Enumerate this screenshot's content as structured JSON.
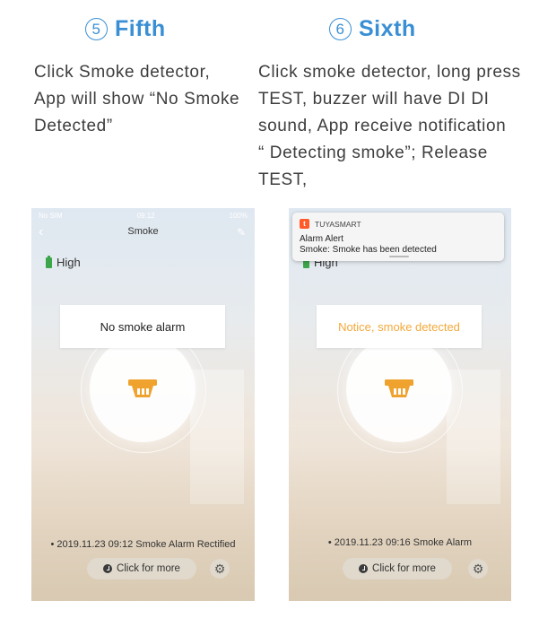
{
  "step5": {
    "number": "5",
    "title": "Fifth",
    "description_lines": [
      "Click Smoke detector,",
      "App will show “No Smoke",
      "Detected”"
    ]
  },
  "step6": {
    "number": "6",
    "title": "Sixth",
    "description_lines": [
      "Click smoke detector, long press",
      "TEST, buzzer will have DI DI",
      "sound, App receive notification",
      "“ Detecting smoke”; Release",
      "TEST,"
    ]
  },
  "screen5": {
    "status_left": "No SIM",
    "status_time": "09:12",
    "status_right": "100%",
    "nav_title": "Smoke",
    "battery_label": "High",
    "alarm_text": "No smoke alarm",
    "history_item": "• 2019.11.23 09:12 Smoke Alarm Rectified",
    "more_button": "Click for more",
    "icons": [
      "back-arrow",
      "edit",
      "battery",
      "smoke-detector",
      "clock",
      "gear"
    ]
  },
  "screen6": {
    "battery_label": "High",
    "notification": {
      "app": "TUYASMART",
      "title": "Alarm Alert",
      "body": "Smoke: Smoke has been detected"
    },
    "alarm_text": "Notice, smoke detected",
    "history_item": "• 2019.11.23 09:16 Smoke Alarm",
    "more_button": "Click for more"
  },
  "colors": {
    "step_title": "#3a8fd4",
    "alert_text": "#f2a93b",
    "detector_icon": "#f0a22e",
    "battery": "#3ea64a"
  }
}
